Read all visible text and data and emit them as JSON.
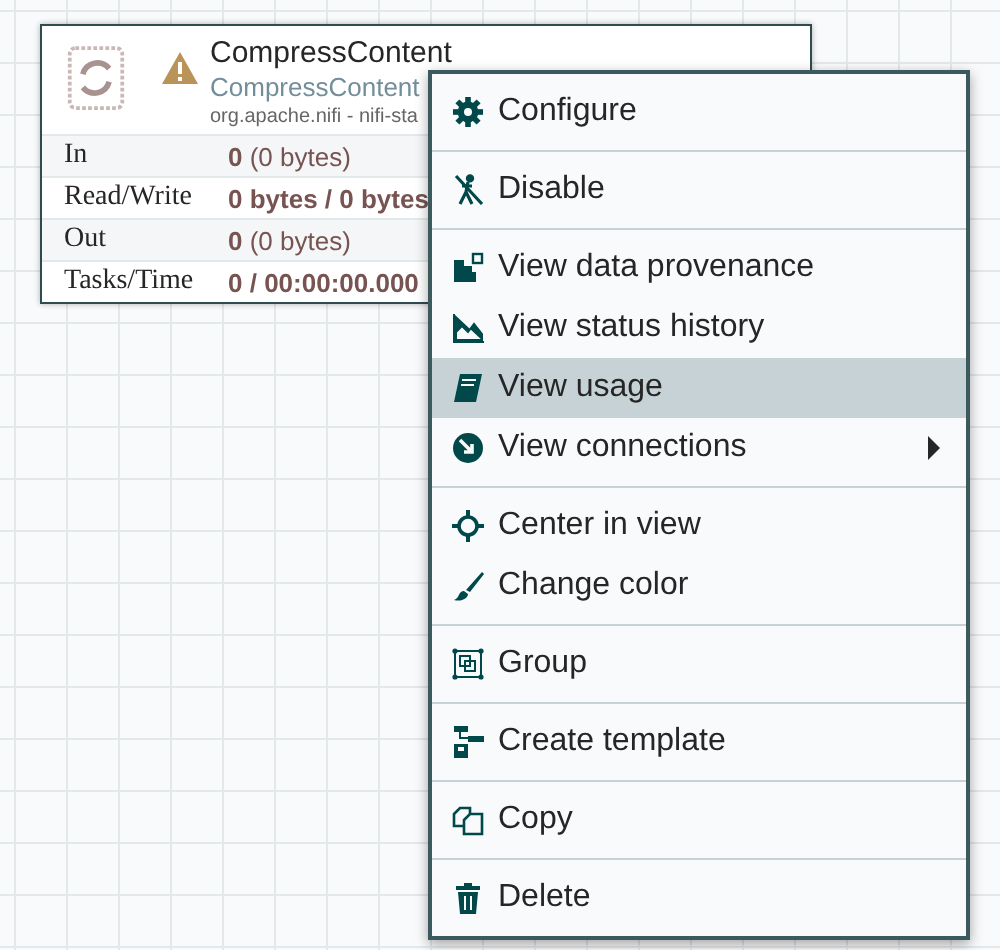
{
  "processor": {
    "name": "CompressContent",
    "type": "CompressContent",
    "bundle": "org.apache.nifi - nifi-sta",
    "warning": true,
    "stats": [
      {
        "label": "In",
        "count": "0",
        "detail": "(0 bytes)"
      },
      {
        "label": "Read/Write",
        "count": "0 bytes / 0 bytes"
      },
      {
        "label": "Out",
        "count": "0",
        "detail": "(0 bytes)"
      },
      {
        "label": "Tasks/Time",
        "count": "0 / 00:00:00.000"
      }
    ]
  },
  "context_menu": {
    "groups": [
      {
        "items": [
          {
            "kind": "configure",
            "label": "Configure",
            "selected": false,
            "submenu": false
          }
        ]
      },
      {
        "items": [
          {
            "kind": "disable",
            "label": "Disable",
            "selected": false,
            "submenu": false
          }
        ]
      },
      {
        "items": [
          {
            "kind": "provenance",
            "label": "View data provenance",
            "selected": false,
            "submenu": false
          },
          {
            "kind": "history",
            "label": "View status history",
            "selected": false,
            "submenu": false
          },
          {
            "kind": "usage",
            "label": "View usage",
            "selected": true,
            "submenu": false
          },
          {
            "kind": "connections",
            "label": "View connections",
            "selected": false,
            "submenu": true
          }
        ]
      },
      {
        "items": [
          {
            "kind": "center",
            "label": "Center in view",
            "selected": false,
            "submenu": false
          },
          {
            "kind": "color",
            "label": "Change color",
            "selected": false,
            "submenu": false
          }
        ]
      },
      {
        "items": [
          {
            "kind": "group",
            "label": "Group",
            "selected": false,
            "submenu": false
          }
        ]
      },
      {
        "items": [
          {
            "kind": "template",
            "label": "Create template",
            "selected": false,
            "submenu": false
          }
        ]
      },
      {
        "items": [
          {
            "kind": "copy",
            "label": "Copy",
            "selected": false,
            "submenu": false
          }
        ]
      },
      {
        "items": [
          {
            "kind": "delete",
            "label": "Delete",
            "selected": false,
            "submenu": false
          }
        ]
      }
    ]
  }
}
